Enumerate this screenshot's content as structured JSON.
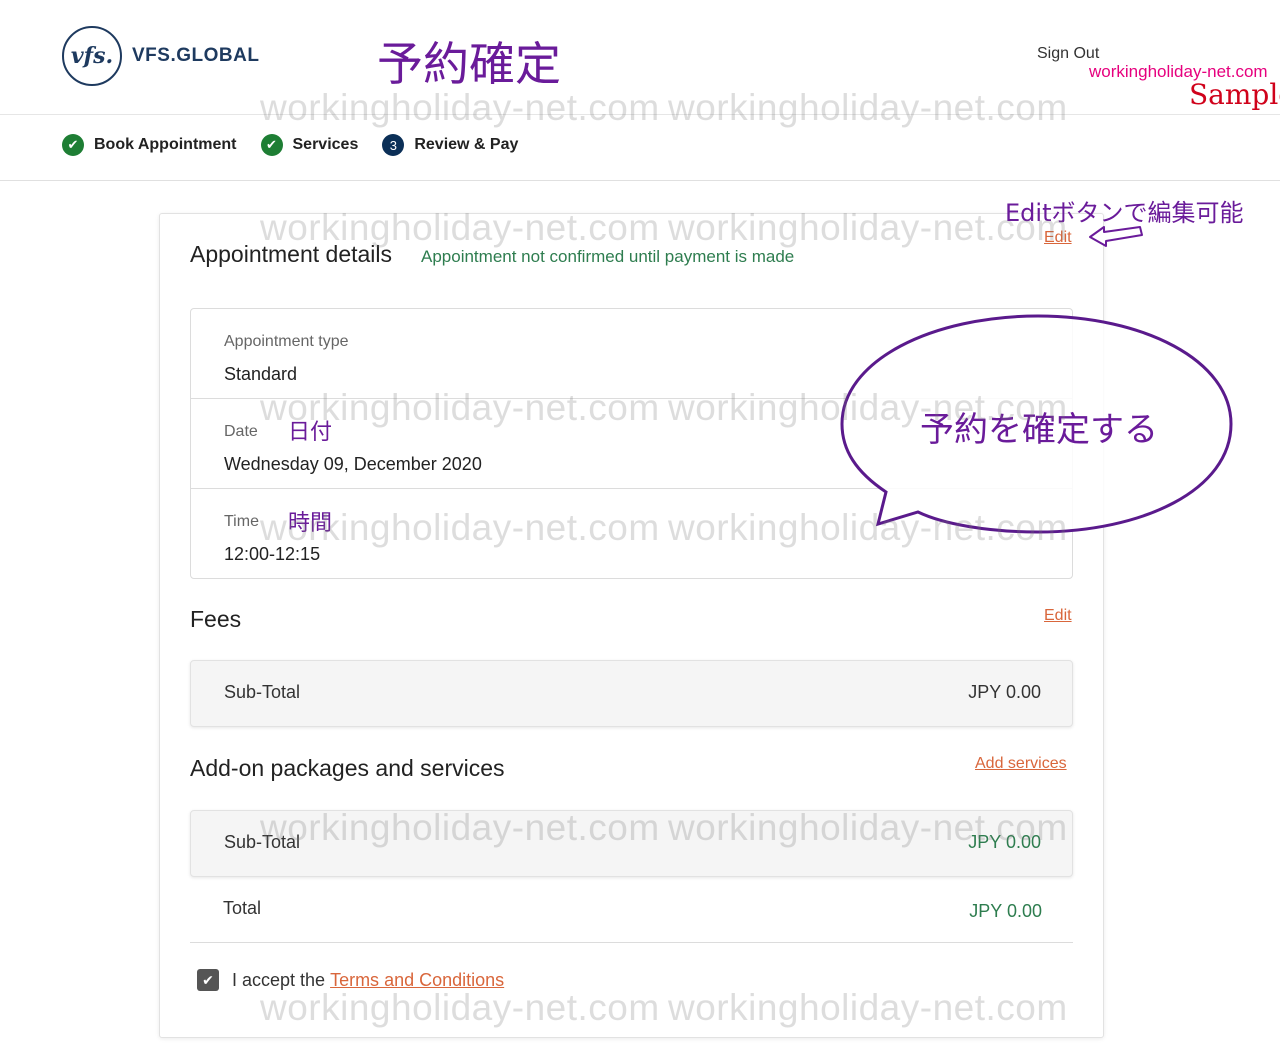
{
  "brand": {
    "logo_mark": "vfs.",
    "logo_text": "VFS.GLOBAL"
  },
  "header": {
    "annotation_title": "予約確定",
    "signout_label": "Sign Out",
    "watermark_site": "workingholiday-net.com",
    "watermark_sample": "Sample"
  },
  "stepper": [
    {
      "label": "Book Appointment",
      "state": "done",
      "icon": "check-icon"
    },
    {
      "label": "Services",
      "state": "done",
      "icon": "check-icon"
    },
    {
      "number": "3",
      "label": "Review & Pay",
      "state": "current"
    }
  ],
  "appointment": {
    "title": "Appointment details",
    "note": "Appointment not confirmed until payment is made",
    "edit_label": "Edit",
    "rows": [
      {
        "label": "Appointment type",
        "value": "Standard"
      },
      {
        "label": "Date",
        "value": "Wednesday 09, December 2020"
      },
      {
        "label": "Time",
        "value": "12:00-12:15"
      }
    ]
  },
  "fees": {
    "title": "Fees",
    "edit_label": "Edit",
    "subtotal_label": "Sub-Total",
    "subtotal_value": "JPY 0.00"
  },
  "addons": {
    "title": "Add-on packages and services",
    "add_label": "Add services",
    "subtotal_label": "Sub-Total",
    "subtotal_value": "JPY 0.00"
  },
  "total": {
    "label": "Total",
    "value": "JPY 0.00"
  },
  "terms": {
    "prefix": "I accept the",
    "link_label": "Terms and Conditions",
    "checked": true
  },
  "annotations": {
    "edit_hint": "Editボタンで編集可能",
    "date_jp": "日付",
    "time_jp": "時間",
    "bubble": "予約を確定する"
  },
  "watermark_text": "workingholiday-net.com",
  "colors": {
    "accent_orange": "#d9663b",
    "success_green": "#1e7e34",
    "note_green": "#2e7d4f",
    "step_navy": "#0b2f57",
    "annotation_purple": "#6a1b9a"
  }
}
